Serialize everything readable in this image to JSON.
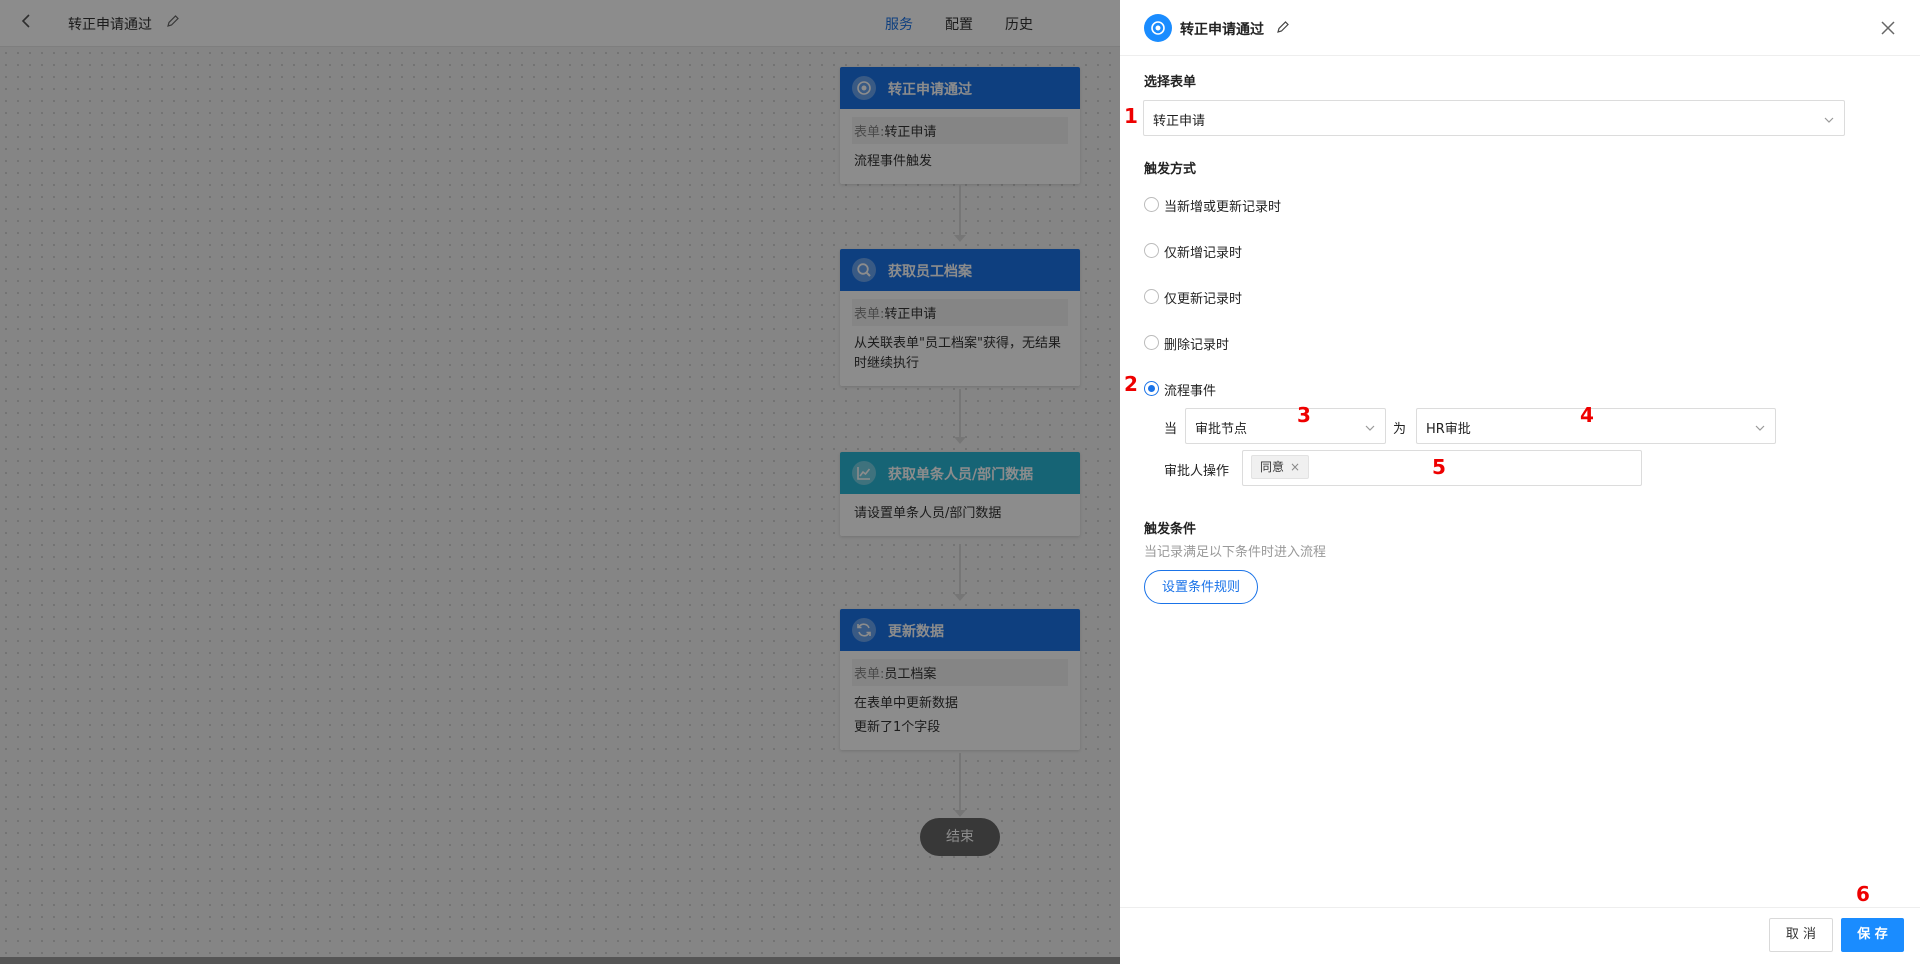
{
  "topbar": {
    "title": "转正申请通过",
    "nav": [
      "服务",
      "配置",
      "历史"
    ]
  },
  "flow": {
    "nodes": [
      {
        "title": "转正申请通过",
        "color": "#1a73e8",
        "form_key": "表单:",
        "form_val": "转正申请",
        "lines": [
          "流程事件触发"
        ]
      },
      {
        "title": "获取员工档案",
        "color": "#1a73e8",
        "form_key": "表单:",
        "form_val": "转正申请",
        "lines": [
          "从关联表单\"员工档案\"获得，无结果",
          "时继续执行"
        ]
      },
      {
        "title": "获取单条人员/部门数据",
        "color": "#29b6d6",
        "lines": [
          "请设置单条人员/部门数据"
        ]
      },
      {
        "title": "更新数据",
        "color": "#1a73e8",
        "form_key": "表单:",
        "form_val": "员工档案",
        "lines": [
          "在表单中更新数据",
          "更新了1个字段"
        ]
      }
    ],
    "end_label": "结束"
  },
  "drawer": {
    "title": "转正申请通过",
    "section_form": "选择表单",
    "form_value": "转正申请",
    "section_trigger": "触发方式",
    "radios": [
      "当新增或更新记录时",
      "仅新增记录时",
      "仅更新记录时",
      "删除记录时",
      "流程事件"
    ],
    "selected_radio": "流程事件",
    "when_label": "当",
    "node_select": "审批节点",
    "is_label": "为",
    "node_value": "HR审批",
    "approver_label": "审批人操作",
    "approver_tag": "同意",
    "section_condition": "触发条件",
    "condition_hint": "当记录满足以下条件时进入流程",
    "condition_button": "设置条件规则",
    "cancel": "取 消",
    "save": "保 存"
  },
  "annotations": [
    "1",
    "2",
    "3",
    "4",
    "5",
    "6"
  ]
}
